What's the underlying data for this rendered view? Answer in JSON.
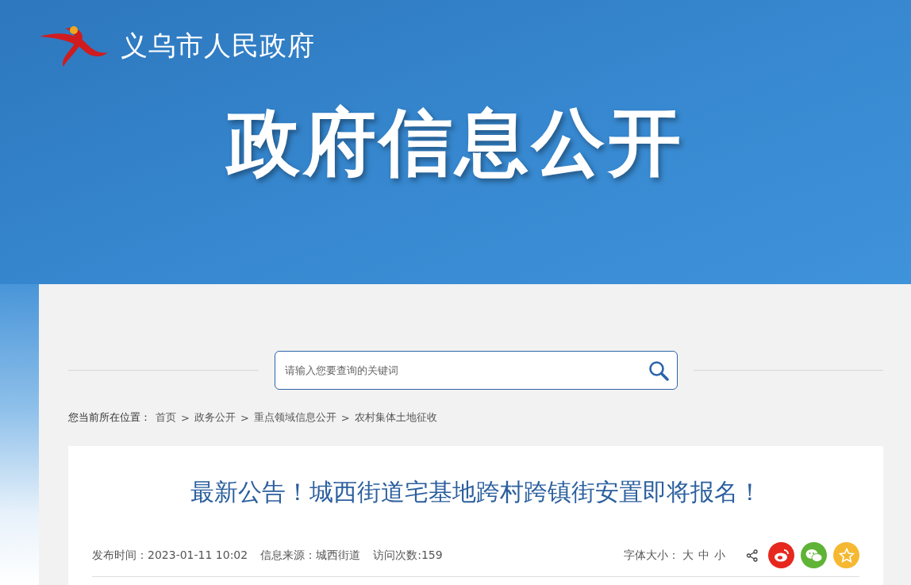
{
  "site": {
    "name": "义乌市人民政府"
  },
  "banner": {
    "title": "政府信息公开"
  },
  "search": {
    "placeholder": "请输入您要查询的关键词"
  },
  "breadcrumb": {
    "label": "您当前所在位置：",
    "items": [
      "首页",
      "政务公开",
      "重点领域信息公开",
      "农村集体土地征收"
    ],
    "separator": ">"
  },
  "article": {
    "title": "最新公告！城西街道宅基地跨村跨镇街安置即将报名！",
    "meta": [
      "发布时间：2023-01-11 10:02",
      "信息来源：城西街道",
      "访问次数:159"
    ],
    "font_size": {
      "label": "字体大小：",
      "options": [
        "大",
        "中",
        "小"
      ]
    },
    "share": [
      {
        "kind": "weibo",
        "color": "#e6281f"
      },
      {
        "kind": "wechat",
        "color": "#5fb336"
      },
      {
        "kind": "favorite",
        "color": "#f5b830"
      }
    ]
  }
}
